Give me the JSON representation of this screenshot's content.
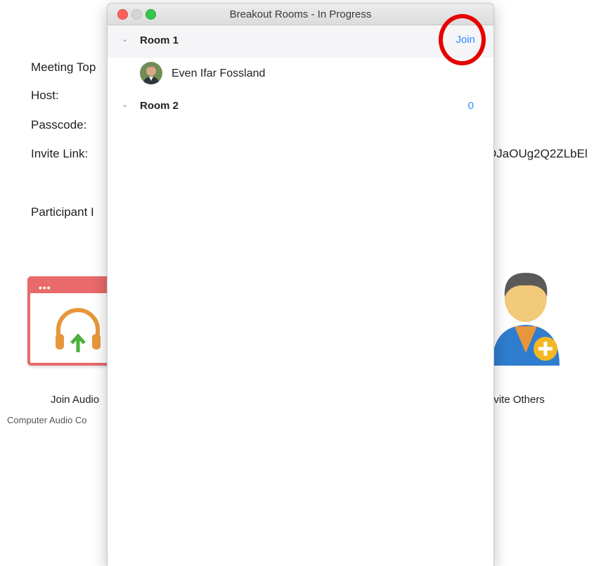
{
  "background": {
    "meeting_topic_label": "Meeting Top",
    "host_label": "Host:",
    "passcode_label": "Passcode:",
    "invite_link_label": "Invite Link:",
    "invite_link_tail": "DJaOUg2Q2ZLbEl",
    "participant_label": "Participant I",
    "join_audio_label": "Join Audio",
    "join_audio_sub": "Computer Audio Co",
    "invite_others_label": "nvite Others"
  },
  "window": {
    "title": "Breakout Rooms - In Progress",
    "rooms": [
      {
        "name": "Room 1",
        "action_label": "Join",
        "participants": [
          {
            "name": "Even Ifar Fossland"
          }
        ]
      },
      {
        "name": "Room 2",
        "count": "0"
      }
    ]
  },
  "colors": {
    "accent": "#2d8cff",
    "highlight": "#e60000",
    "audio_tile": "#e86a6a"
  },
  "icons": {
    "chevron": "chevron-down-icon",
    "headphones": "headphones-icon",
    "invite": "add-user-icon"
  }
}
